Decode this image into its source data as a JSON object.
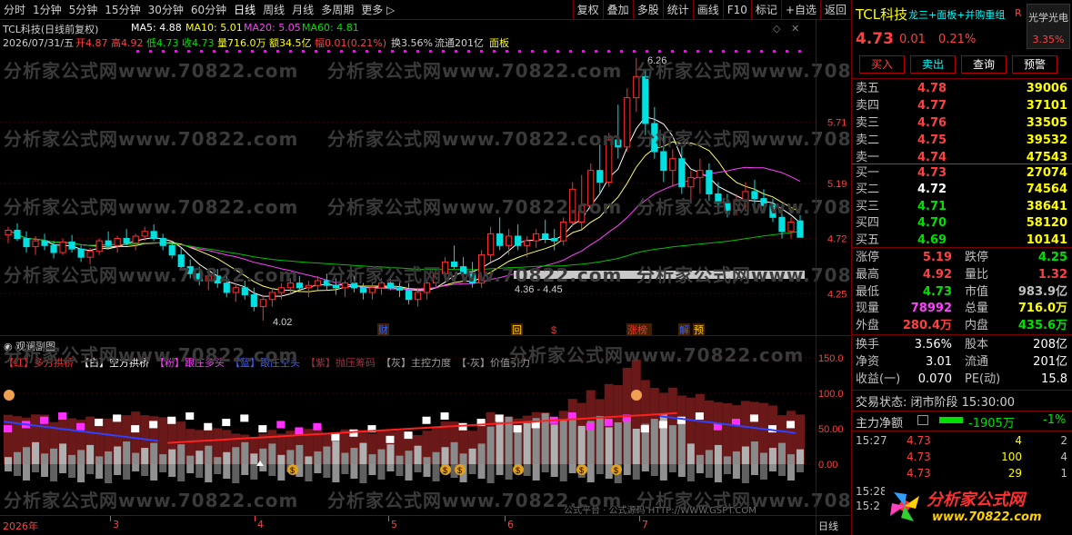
{
  "toolbar": {
    "periods": [
      "分时",
      "1分钟",
      "5分钟",
      "15分钟",
      "30分钟",
      "60分钟",
      "日线",
      "周线",
      "月线",
      "多周期",
      "更多 ▷"
    ],
    "tools": [
      "复权",
      "叠加",
      "多股",
      "统计",
      "画线",
      "F10",
      "标记",
      "+自选",
      "返回"
    ]
  },
  "main": {
    "title": "TCL科技(日线前复权)",
    "ma": {
      "ma5": "MA5: 4.88",
      "ma10": "MA10: 5.01",
      "ma20": "MA20: 5.05",
      "ma60": "MA60: 4.81"
    },
    "quote_line": {
      "date": "2026/07/31/五",
      "open": "开4.87",
      "high": "高4.92",
      "low": "低4.73",
      "close": "收4.73",
      "vol": "量716.0万",
      "amt": "额34.5亿",
      "range": "幅0.01(0.21%)",
      "turnover": "换3.56%",
      "float": "流通201亿",
      "board": "面板"
    },
    "y_ticks": [
      "5.71",
      "5.19",
      "4.72",
      "4.25"
    ],
    "annotations": {
      "high": "6.26",
      "low": "4.02",
      "range": "4.36 - 4.45"
    },
    "markers": [
      "财",
      "回",
      "$",
      "涨榜",
      "解",
      "预"
    ],
    "watermark": "分析家公式网www.70822.com"
  },
  "sub": {
    "title": "观澜副图",
    "legend": [
      {
        "text": "【红】多方拱桥",
        "color": "#ff3030"
      },
      {
        "text": "【白】空方拱桥",
        "color": "#ffffff"
      },
      {
        "text": "【粉】跟庄多头",
        "color": "#ff40ff"
      },
      {
        "text": "【蓝】跟庄空头",
        "color": "#4060ff"
      },
      {
        "text": "【紫】抛压筹码",
        "color": "#a03040"
      },
      {
        "text": "【灰】主控力度",
        "color": "#a0a0a0"
      },
      {
        "text": "【-灰】价值引力",
        "color": "#a0a0a0"
      }
    ],
    "y_ticks": [
      "150.0",
      "100.0",
      "50.00",
      "0.00"
    ],
    "footer": "公式平台 · 公式源码 HTTP://WWW.GSPT.COM"
  },
  "xaxis": {
    "labels": [
      "2026年",
      "3",
      "4",
      "5",
      "6",
      "7"
    ],
    "period": "日线"
  },
  "right": {
    "name": "TCL科技",
    "tags": "龙三+面板+并购重组",
    "r": "R",
    "concept": "光学光电",
    "price": "4.73",
    "change": "0.01",
    "pct": "0.21%",
    "concept_pct": "3.35%",
    "buttons": [
      "买入",
      "卖出",
      "查询",
      "预警"
    ],
    "asks": [
      {
        "label": "卖五",
        "price": "4.78",
        "vol": "39006"
      },
      {
        "label": "卖四",
        "price": "4.77",
        "vol": "37101"
      },
      {
        "label": "卖三",
        "price": "4.76",
        "vol": "33505"
      },
      {
        "label": "卖二",
        "price": "4.75",
        "vol": "39532"
      },
      {
        "label": "卖一",
        "price": "4.74",
        "vol": "47543"
      }
    ],
    "bids": [
      {
        "label": "买一",
        "price": "4.73",
        "vol": "27074"
      },
      {
        "label": "买二",
        "price": "4.72",
        "vol": "74564"
      },
      {
        "label": "买三",
        "price": "4.71",
        "vol": "38641"
      },
      {
        "label": "买四",
        "price": "4.70",
        "vol": "58120"
      },
      {
        "label": "买五",
        "price": "4.69",
        "vol": "10141"
      }
    ],
    "stats": [
      {
        "l1": "涨停",
        "v1": "5.19",
        "l2": "跌停",
        "v2": "4.25"
      },
      {
        "l1": "最高",
        "v1": "4.92",
        "l2": "量比",
        "v2": "1.32"
      },
      {
        "l1": "最低",
        "v1": "4.73",
        "l2": "市值",
        "v2": "983.9亿"
      },
      {
        "l1": "现量",
        "v1": "78992",
        "l2": "总量",
        "v2": "716.0万"
      },
      {
        "l1": "外盘",
        "v1": "280.4万",
        "l2": "内盘",
        "v2": "435.6万"
      }
    ],
    "stats2": [
      {
        "l1": "换手",
        "v1": "3.56%",
        "l2": "股本",
        "v2": "208亿"
      },
      {
        "l1": "净资",
        "v1": "3.01",
        "l2": "流通",
        "v2": "201亿"
      },
      {
        "l1": "收益(一)",
        "v1": "0.070",
        "l2": "PE(动)",
        "v2": "15.8"
      }
    ],
    "trade_state": "交易状态: 闭市阶段 15:30:00",
    "main_net": {
      "label": "主力净额",
      "value": "-1905万",
      "pct": "-1%"
    },
    "ticks": [
      {
        "time": "15:27",
        "price": "4.73",
        "vol": "4",
        "n": "2"
      },
      {
        "time": "",
        "price": "4.73",
        "vol": "100",
        "n": "4"
      },
      {
        "time": "",
        "price": "4.73",
        "vol": "29",
        "n": "1"
      }
    ],
    "ticks_tail": [
      "15:28",
      "15:2"
    ],
    "logo_text": "分析家公式网",
    "logo_url": "www.70822.com"
  },
  "chart_data": {
    "type": "candlestick",
    "ylim": [
      3.95,
      6.35
    ],
    "candles": [
      [
        4.75,
        4.82,
        4.68,
        4.79
      ],
      [
        4.79,
        4.85,
        4.7,
        4.72
      ],
      [
        4.72,
        4.78,
        4.6,
        4.65
      ],
      [
        4.65,
        4.74,
        4.58,
        4.7
      ],
      [
        4.7,
        4.76,
        4.62,
        4.66
      ],
      [
        4.66,
        4.7,
        4.55,
        4.6
      ],
      [
        4.6,
        4.72,
        4.58,
        4.69
      ],
      [
        4.69,
        4.75,
        4.6,
        4.63
      ],
      [
        4.63,
        4.66,
        4.52,
        4.56
      ],
      [
        4.56,
        4.64,
        4.5,
        4.61
      ],
      [
        4.61,
        4.72,
        4.58,
        4.7
      ],
      [
        4.7,
        4.78,
        4.64,
        4.66
      ],
      [
        4.66,
        4.74,
        4.6,
        4.72
      ],
      [
        4.72,
        4.8,
        4.66,
        4.68
      ],
      [
        4.68,
        4.76,
        4.62,
        4.74
      ],
      [
        4.74,
        4.82,
        4.7,
        4.78
      ],
      [
        4.78,
        4.84,
        4.7,
        4.72
      ],
      [
        4.72,
        4.76,
        4.62,
        4.66
      ],
      [
        4.66,
        4.7,
        4.55,
        4.58
      ],
      [
        4.58,
        4.64,
        4.45,
        4.48
      ],
      [
        4.48,
        4.54,
        4.38,
        4.42
      ],
      [
        4.42,
        4.48,
        4.32,
        4.36
      ],
      [
        4.36,
        4.44,
        4.28,
        4.4
      ],
      [
        4.4,
        4.46,
        4.3,
        4.34
      ],
      [
        4.34,
        4.4,
        4.22,
        4.26
      ],
      [
        4.26,
        4.34,
        4.18,
        4.3
      ],
      [
        4.3,
        4.36,
        4.2,
        4.24
      ],
      [
        4.24,
        4.3,
        4.1,
        4.14
      ],
      [
        4.14,
        4.24,
        4.02,
        4.2
      ],
      [
        4.2,
        4.3,
        4.14,
        4.26
      ],
      [
        4.26,
        4.34,
        4.2,
        4.3
      ],
      [
        4.3,
        4.38,
        4.24,
        4.34
      ],
      [
        4.34,
        4.4,
        4.26,
        4.3
      ],
      [
        4.3,
        4.36,
        4.22,
        4.32
      ],
      [
        4.32,
        4.4,
        4.28,
        4.36
      ],
      [
        4.36,
        4.42,
        4.28,
        4.32
      ],
      [
        4.32,
        4.38,
        4.24,
        4.3
      ],
      [
        4.3,
        4.36,
        4.22,
        4.34
      ],
      [
        4.34,
        4.4,
        4.26,
        4.3
      ],
      [
        4.3,
        4.34,
        4.2,
        4.26
      ],
      [
        4.26,
        4.34,
        4.2,
        4.3
      ],
      [
        4.3,
        4.38,
        4.24,
        4.34
      ],
      [
        4.34,
        4.4,
        4.28,
        4.3
      ],
      [
        4.3,
        4.36,
        4.22,
        4.28
      ],
      [
        4.28,
        4.34,
        4.16,
        4.2
      ],
      [
        4.2,
        4.3,
        4.14,
        4.26
      ],
      [
        4.26,
        4.36,
        4.2,
        4.34
      ],
      [
        4.34,
        4.44,
        4.3,
        4.42
      ],
      [
        4.42,
        4.56,
        4.36,
        4.52
      ],
      [
        4.52,
        4.66,
        4.46,
        4.48
      ],
      [
        4.48,
        4.56,
        4.38,
        4.42
      ],
      [
        4.42,
        4.52,
        4.3,
        4.34
      ],
      [
        4.34,
        4.62,
        4.3,
        4.58
      ],
      [
        4.58,
        4.82,
        4.52,
        4.76
      ],
      [
        4.76,
        4.9,
        4.62,
        4.66
      ],
      [
        4.66,
        4.8,
        4.58,
        4.74
      ],
      [
        4.74,
        4.84,
        4.62,
        4.66
      ],
      [
        4.66,
        4.74,
        4.56,
        4.7
      ],
      [
        4.7,
        4.8,
        4.64,
        4.76
      ],
      [
        4.76,
        4.88,
        4.68,
        4.72
      ],
      [
        4.72,
        4.8,
        4.62,
        4.7
      ],
      [
        4.7,
        4.9,
        4.66,
        4.86
      ],
      [
        4.86,
        5.2,
        4.82,
        5.14
      ],
      [
        4.86,
        5.26,
        4.8,
        5.0
      ],
      [
        5.0,
        5.36,
        4.96,
        5.3
      ],
      [
        5.3,
        5.52,
        5.1,
        5.2
      ],
      [
        5.2,
        5.62,
        5.16,
        5.56
      ],
      [
        5.56,
        5.86,
        5.4,
        5.5
      ],
      [
        5.5,
        6.0,
        5.46,
        5.92
      ],
      [
        5.92,
        6.26,
        5.8,
        6.1
      ],
      [
        6.1,
        6.16,
        5.6,
        5.7
      ],
      [
        5.7,
        5.84,
        5.4,
        5.46
      ],
      [
        5.46,
        5.6,
        5.2,
        5.3
      ],
      [
        5.3,
        5.48,
        5.16,
        5.4
      ],
      [
        5.4,
        5.5,
        5.1,
        5.16
      ],
      [
        5.16,
        5.3,
        5.02,
        5.24
      ],
      [
        5.24,
        5.4,
        5.1,
        5.3
      ],
      [
        5.3,
        5.36,
        5.04,
        5.1
      ],
      [
        5.1,
        5.2,
        4.96,
        5.02
      ],
      [
        5.02,
        5.1,
        4.9,
        4.96
      ],
      [
        4.96,
        5.1,
        4.92,
        5.04
      ],
      [
        5.04,
        5.2,
        4.98,
        5.12
      ],
      [
        5.12,
        5.22,
        5.0,
        5.06
      ],
      [
        5.06,
        5.14,
        4.96,
        5.0
      ],
      [
        5.0,
        5.06,
        4.86,
        4.9
      ],
      [
        4.9,
        4.96,
        4.72,
        4.78
      ],
      [
        4.78,
        4.9,
        4.72,
        4.86
      ],
      [
        4.87,
        4.92,
        4.73,
        4.73
      ]
    ]
  }
}
